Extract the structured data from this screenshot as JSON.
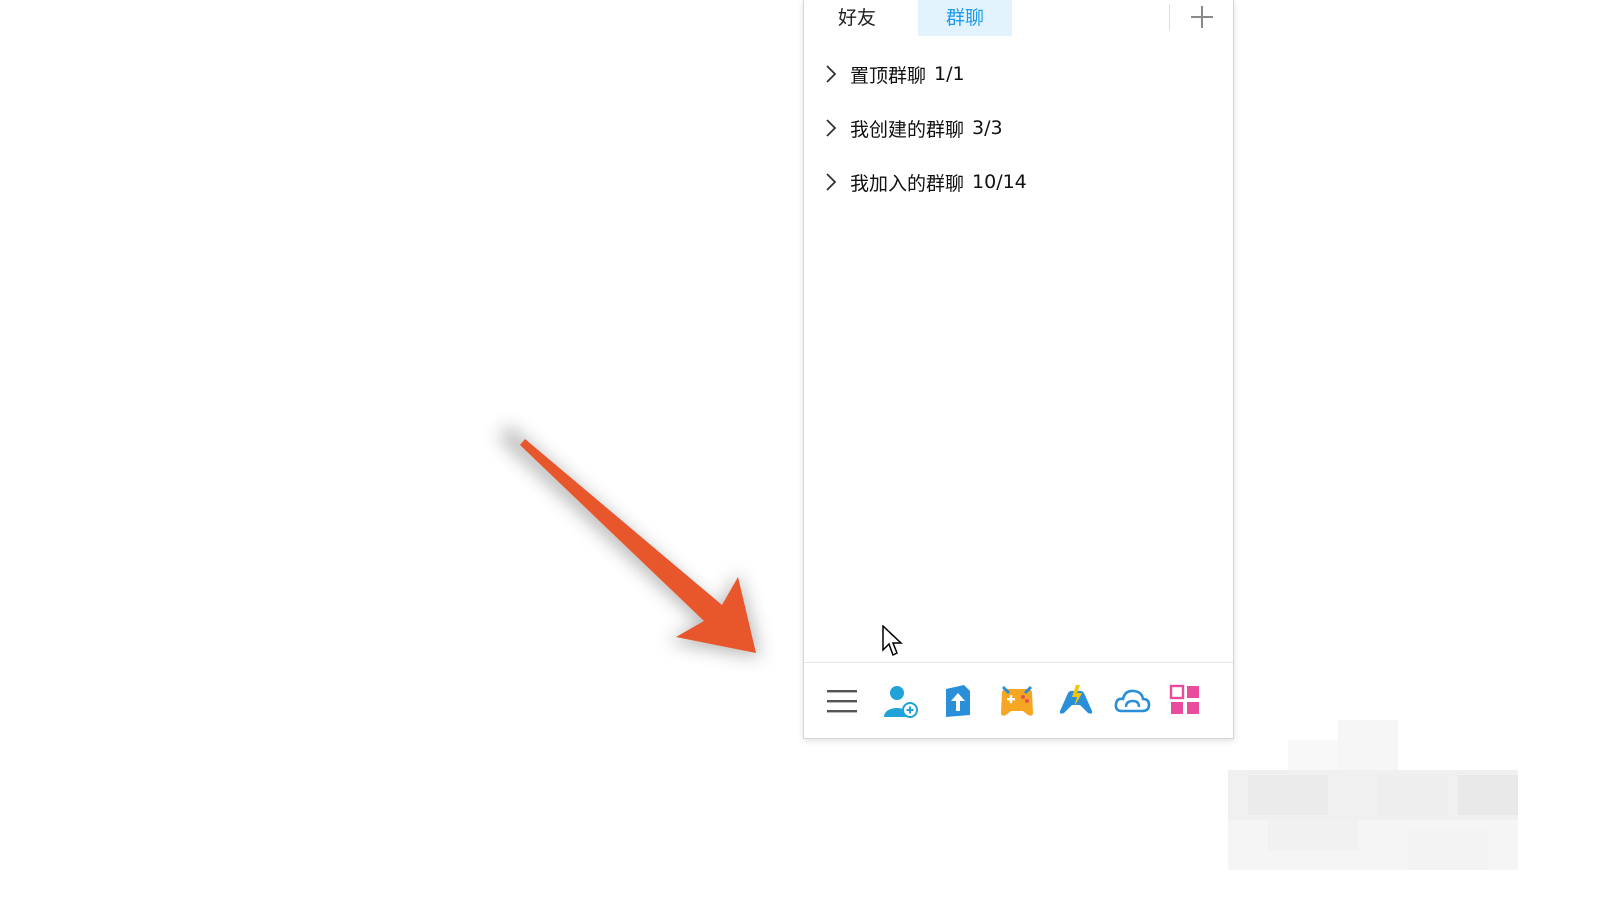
{
  "tabs": {
    "friends": "好友",
    "groups": "群聊"
  },
  "groups": [
    {
      "name": "置顶群聊",
      "count": "1/1"
    },
    {
      "name": "我创建的群聊",
      "count": "3/3"
    },
    {
      "name": "我加入的群聊",
      "count": "10/14"
    }
  ],
  "toolbar": {
    "icons": [
      "menu-icon",
      "add-contact-icon",
      "app-store-icon",
      "game-center-icon",
      "game-icon",
      "cloud-icon",
      "grid-icon"
    ]
  },
  "colors": {
    "accent": "#1e9be9",
    "tab_active_bg": "#e3f3fd",
    "arrow": "#e8572b"
  }
}
